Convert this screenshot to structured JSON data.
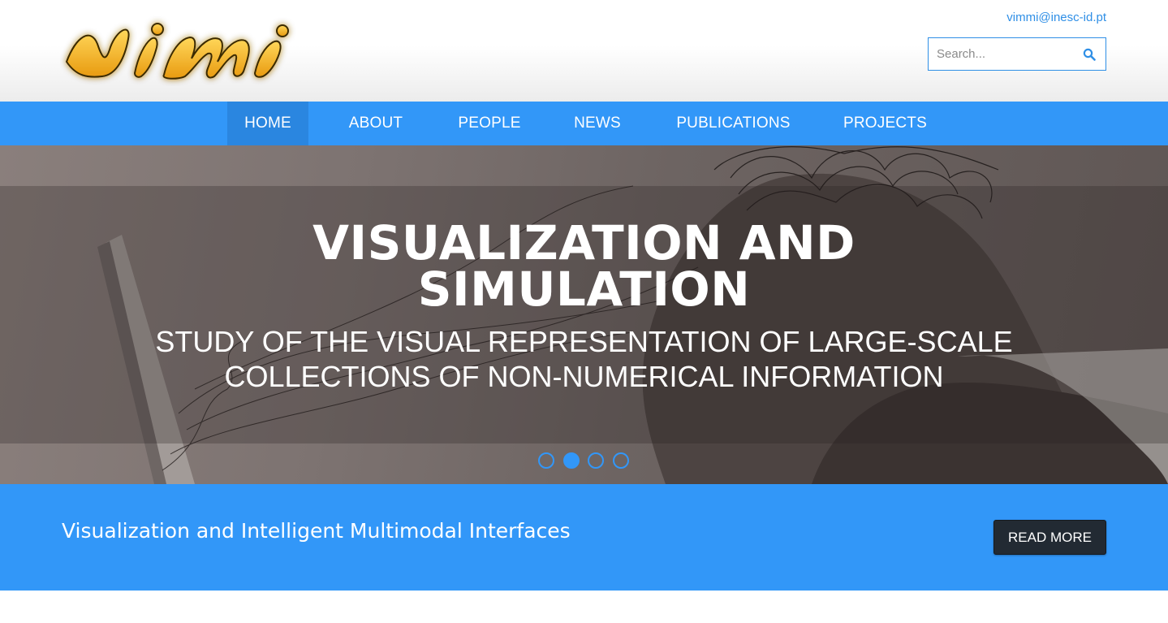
{
  "header": {
    "logo_text": "vimmi",
    "email": "vimmi@inesc-id.pt",
    "search": {
      "placeholder": "Search...",
      "value": ""
    }
  },
  "nav": {
    "items": [
      {
        "label": "HOME",
        "active": true
      },
      {
        "label": "ABOUT",
        "active": false
      },
      {
        "label": "PEOPLE",
        "active": false
      },
      {
        "label": "NEWS",
        "active": false
      },
      {
        "label": "PUBLICATIONS",
        "active": false
      },
      {
        "label": "PROJECTS",
        "active": false
      }
    ]
  },
  "hero": {
    "title_lines": [
      "VISUALIZATION AND",
      "SIMULATION"
    ],
    "subtitle_lines": [
      "STUDY OF THE VISUAL REPRESENTATION OF LARGE-SCALE",
      "COLLECTIONS OF NON-NUMERICAL INFORMATION"
    ],
    "slides_count": 4,
    "active_slide": 2
  },
  "banner": {
    "text": "Visualization and Intelligent Multimodal Interfaces",
    "button_label": "READ MORE"
  },
  "colors": {
    "accent": "#3297f8",
    "nav_active": "#2a86e0",
    "button_dark": "#222a33",
    "logo_yellow": "#f5b321"
  },
  "icons": {
    "search": "search-icon"
  }
}
